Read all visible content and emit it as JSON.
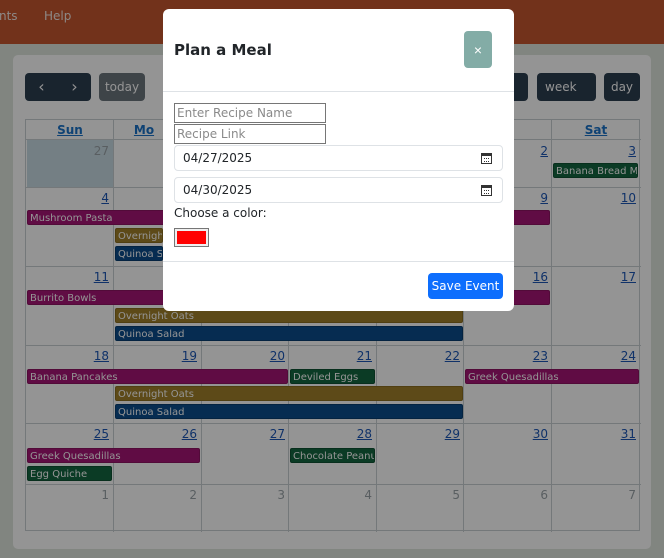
{
  "nav": {
    "items": [
      "nts",
      "Help"
    ]
  },
  "toolbar": {
    "prev_icon": "chevron-left-icon",
    "prev_glyph": "‹",
    "next_icon": "chevron-right-icon",
    "next_glyph": "›",
    "today_label": "today",
    "week_label": "week",
    "day_label": "day"
  },
  "calendar": {
    "day_headers": [
      "Sun",
      "Mo",
      "",
      "",
      "",
      "",
      "Sat"
    ],
    "weeks": [
      {
        "days": [
          "27",
          "",
          "",
          "",
          "",
          "2",
          "3"
        ],
        "other_month": [
          true,
          false,
          false,
          false,
          false,
          false,
          false
        ]
      },
      {
        "days": [
          "4",
          "",
          "",
          "",
          "",
          "9",
          "10"
        ],
        "other_month": [
          false,
          false,
          false,
          false,
          false,
          false,
          false
        ]
      },
      {
        "days": [
          "11",
          "",
          "",
          "",
          "",
          "16",
          "17"
        ],
        "other_month": [
          false,
          false,
          false,
          false,
          false,
          false,
          false
        ]
      },
      {
        "days": [
          "18",
          "19",
          "20",
          "21",
          "22",
          "23",
          "24"
        ],
        "other_month": [
          false,
          false,
          false,
          false,
          false,
          false,
          false
        ]
      },
      {
        "days": [
          "25",
          "26",
          "27",
          "28",
          "29",
          "30",
          "31"
        ],
        "other_month": [
          false,
          false,
          false,
          false,
          false,
          false,
          false
        ]
      },
      {
        "days": [
          "1",
          "2",
          "3",
          "4",
          "5",
          "6",
          "7"
        ],
        "other_month": [
          true,
          true,
          true,
          true,
          true,
          true,
          true
        ]
      }
    ],
    "events": [
      {
        "title": "Banana Bread Muf",
        "color": "green"
      },
      {
        "title": "Mushroom Pasta",
        "color": "magenta"
      },
      {
        "title": "Overnight Oats",
        "color": "gold"
      },
      {
        "title": "Quinoa Sa",
        "color": "blue"
      },
      {
        "title": "Burrito Bowls",
        "color": "magenta"
      },
      {
        "title": "Overnight Oats",
        "color": "gold"
      },
      {
        "title": "Quinoa Salad",
        "color": "blue"
      },
      {
        "title": "Banana Pancakes",
        "color": "magenta"
      },
      {
        "title": "Deviled Eggs",
        "color": "green"
      },
      {
        "title": "Greek Quesadillas",
        "color": "magenta"
      },
      {
        "title": "Overnight Oats",
        "color": "gold"
      },
      {
        "title": "Quinoa Salad",
        "color": "blue"
      },
      {
        "title": "Greek Quesadillas",
        "color": "magenta"
      },
      {
        "title": "Chocolate Peanut",
        "color": "green"
      },
      {
        "title": "Egg Quiche",
        "color": "green"
      }
    ]
  },
  "modal": {
    "title": "Plan a Meal",
    "close_glyph": "×",
    "recipe_name_placeholder": "Enter Recipe Name",
    "recipe_link_placeholder": "Recipe Link",
    "start_date": "04/27/2025",
    "end_date": "04/30/2025",
    "color_label": "Choose a color:",
    "selected_color": "#ff0000",
    "save_label": "Save Event"
  }
}
